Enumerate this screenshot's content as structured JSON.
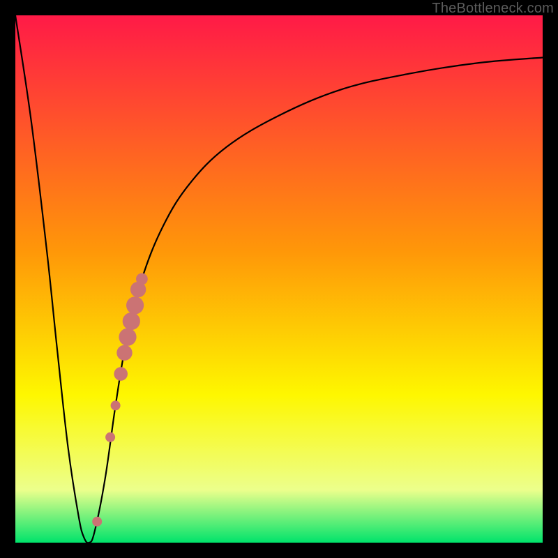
{
  "watermark": "TheBottleneck.com",
  "colors": {
    "black": "#000000",
    "curve": "#000000",
    "dot": "#cb7374",
    "gradient_top": "#ff1a47",
    "gradient_upper_mid": "#ff9808",
    "gradient_mid": "#fef700",
    "gradient_pale": "#ecff8c",
    "gradient_bottom": "#00e36b"
  },
  "chart_data": {
    "type": "line",
    "title": "",
    "xlabel": "",
    "ylabel": "",
    "xlim": [
      0,
      100
    ],
    "ylim": [
      0,
      100
    ],
    "grid": false,
    "legend": false,
    "series": [
      {
        "name": "bottleneck-curve",
        "x": [
          0,
          3,
          6,
          8,
          10,
          12,
          13,
          14,
          15,
          17,
          19,
          21,
          24,
          28,
          33,
          40,
          50,
          62,
          75,
          88,
          100
        ],
        "values": [
          100,
          80,
          55,
          36,
          18,
          5,
          1,
          0,
          2,
          12,
          26,
          38,
          50,
          60,
          68,
          75,
          81,
          86,
          89,
          91,
          92
        ]
      }
    ],
    "markers": [
      {
        "x": 15.5,
        "y": 4,
        "r": 1.0
      },
      {
        "x": 18.0,
        "y": 20,
        "r": 1.0
      },
      {
        "x": 19.0,
        "y": 26,
        "r": 1.0
      },
      {
        "x": 20.0,
        "y": 32,
        "r": 1.4
      },
      {
        "x": 20.7,
        "y": 36,
        "r": 1.6
      },
      {
        "x": 21.3,
        "y": 39,
        "r": 1.8
      },
      {
        "x": 22.0,
        "y": 42,
        "r": 1.8
      },
      {
        "x": 22.7,
        "y": 45,
        "r": 1.8
      },
      {
        "x": 23.3,
        "y": 48,
        "r": 1.6
      },
      {
        "x": 24.0,
        "y": 50,
        "r": 1.2
      }
    ]
  }
}
